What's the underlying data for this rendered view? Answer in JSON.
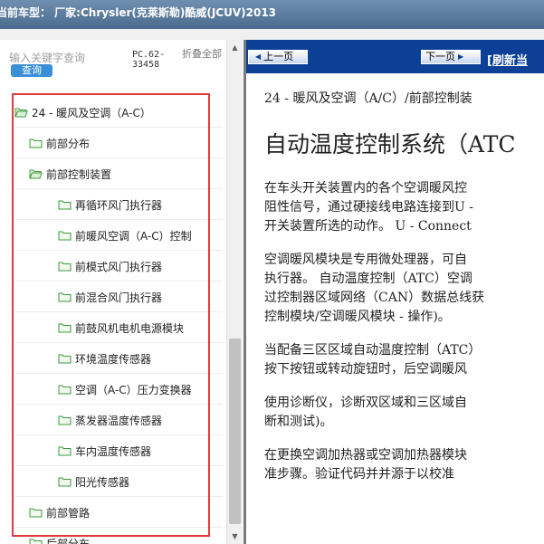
{
  "window": {
    "title": "当前车型：  厂家:Chrysler(克莱斯勒)酷威(JCUV)2013"
  },
  "left_panel": {
    "search": {
      "placeholder": "输入关键字查询",
      "button_label": "查询"
    },
    "pc_code": "PC.62-33458",
    "collapse_all": "折叠全部",
    "tree": [
      {
        "label": "24 - 暖风及空调（A-C）",
        "level": 0,
        "open": true
      },
      {
        "label": "前部分布",
        "level": 1,
        "open": false
      },
      {
        "label": "前部控制装置",
        "level": 1,
        "open": true
      },
      {
        "label": "再循环风门执行器",
        "level": 2,
        "open": false
      },
      {
        "label": "前暖风空调（A-C）控制",
        "level": 2,
        "open": false
      },
      {
        "label": "前模式风门执行器",
        "level": 2,
        "open": false
      },
      {
        "label": "前混合风门执行器",
        "level": 2,
        "open": false
      },
      {
        "label": "前鼓风机电机电源模块",
        "level": 2,
        "open": false
      },
      {
        "label": "环境温度传感器",
        "level": 2,
        "open": false
      },
      {
        "label": "空调（A-C）压力变换器",
        "level": 2,
        "open": false
      },
      {
        "label": "蒸发器温度传感器",
        "level": 2,
        "open": false
      },
      {
        "label": "车内温度传感器",
        "level": 2,
        "open": false
      },
      {
        "label": "阳光传感器",
        "level": 2,
        "open": false
      },
      {
        "label": "前部管路",
        "level": 1,
        "open": false
      },
      {
        "label": "后部分布",
        "level": 1,
        "open": false
      }
    ],
    "scroll_up_icon": "▲",
    "scroll_down_icon": "▼"
  },
  "right_panel": {
    "nav": {
      "prev_label": "上一页",
      "next_label": "下一页",
      "refresh_label": "[刷新当"
    },
    "breadcrumb": "24 - 暖风及空调（A/C）/前部控制装",
    "heading": "自动温度控制系统（ATC",
    "paragraphs": [
      "在车头开关装置内的各个空调暖风控\n阻性信号，通过硬接线电路连接到U -\n开关装置所选的动作。 U - Connect",
      "空调暖风模块是专用微处理器，可自\n执行器。 自动温度控制（ATC）空调\n过控制器区域网络（CAN）数据总线获\n控制模块/空调暖风模块 - 操作)。",
      "当配备三区区域自动温度控制（ATC）\n按下按钮或转动旋钮时，后空调暖风",
      "使用诊断仪，诊断双区域和三区域自\n断和测试)。",
      "在更换空调加热器或空调加热器模块\n准步骤。验证代码并并源于以校准"
    ]
  },
  "colors": {
    "titlebar": "#4a6b8d",
    "nav_bar": "#0c3f96",
    "highlight_border": "#e23a3a",
    "query_button": "#3a8fd6",
    "folder_icon": "#3a9a3a"
  }
}
